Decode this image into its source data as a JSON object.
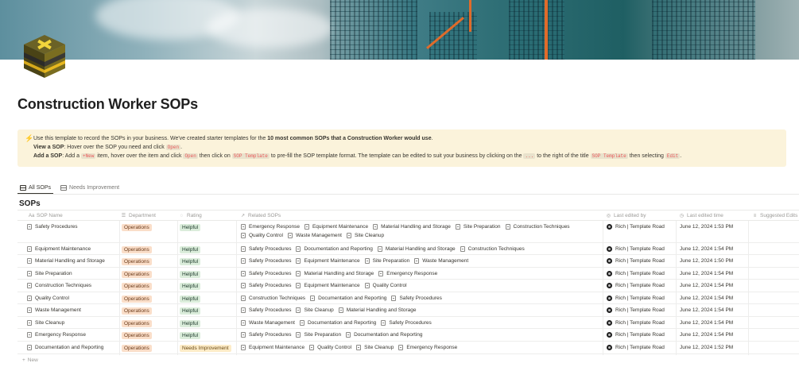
{
  "page": {
    "title": "Construction Worker SOPs"
  },
  "callout": {
    "line1_prefix": "Use this template to record the SOPs in your business. We've created starter templates for the ",
    "line1_bold": "10 most common SOPs that a Construction Worker would use",
    "line1_suffix": ".",
    "line2_bold": "View a SOP",
    "line2_text": ": Hover over the SOP you need and click ",
    "line2_code": "Open",
    "line2_end": ".",
    "line3_bold": "Add a SOP",
    "line3_a": ": Add a ",
    "line3_code_new": "+New",
    "line3_b": " item, hover over the item and click ",
    "line3_code_open": "Open",
    "line3_c": " then click on ",
    "line3_code_template": "SOP Template",
    "line3_d": " to pre-fill the SOP template format. The template can be edited to suit your business by clicking on the ",
    "line3_code_dots": "...",
    "line3_e": " to the right of the title ",
    "line3_code_template2": "SOP Template",
    "line3_f": " then selecting ",
    "line3_code_edit": "Edit",
    "line3_g": "."
  },
  "tabs": [
    {
      "label": "All SOPs",
      "active": true
    },
    {
      "label": "Needs Improvement",
      "active": false
    }
  ],
  "database": {
    "title": "SOPs",
    "columns": {
      "name": "SOP Name",
      "department": "Department",
      "rating": "Rating",
      "related": "Related SOPs",
      "last_edited_by": "Last edited by",
      "last_edited_time": "Last edited time",
      "suggested": "Suggested Edits"
    },
    "new_label": "New"
  },
  "rows": [
    {
      "name": "Safety Procedures",
      "department": "Operations",
      "rating": "Helpful",
      "related_line1": [
        "Emergency Response",
        "Equipment Maintenance",
        "Material Handling and Storage",
        "Site Preparation",
        "Construction Techniques"
      ],
      "related_line2": [
        "Quality Control",
        "Waste Management",
        "Site Cleanup"
      ],
      "editor": "Rich | Template Road",
      "time": "June 12, 2024 1:53 PM"
    },
    {
      "name": "Equipment Maintenance",
      "department": "Operations",
      "rating": "Helpful",
      "related_line1": [
        "Safety Procedures",
        "Documentation and Reporting",
        "Material Handling and Storage",
        "Construction Techniques"
      ],
      "editor": "Rich | Template Road",
      "time": "June 12, 2024 1:54 PM"
    },
    {
      "name": "Material Handling and Storage",
      "department": "Operations",
      "rating": "Helpful",
      "related_line1": [
        "Safety Procedures",
        "Equipment Maintenance",
        "Site Preparation",
        "Waste Management"
      ],
      "editor": "Rich | Template Road",
      "time": "June 12, 2024 1:50 PM"
    },
    {
      "name": "Site Preparation",
      "department": "Operations",
      "rating": "Helpful",
      "related_line1": [
        "Safety Procedures",
        "Material Handling and Storage",
        "Emergency Response"
      ],
      "editor": "Rich | Template Road",
      "time": "June 12, 2024 1:54 PM"
    },
    {
      "name": "Construction Techniques",
      "department": "Operations",
      "rating": "Helpful",
      "related_line1": [
        "Safety Procedures",
        "Equipment Maintenance",
        "Quality Control"
      ],
      "editor": "Rich | Template Road",
      "time": "June 12, 2024 1:54 PM"
    },
    {
      "name": "Quality Control",
      "department": "Operations",
      "rating": "Helpful",
      "related_line1": [
        "Construction Techniques",
        "Documentation and Reporting",
        "Safety Procedures"
      ],
      "editor": "Rich | Template Road",
      "time": "June 12, 2024 1:54 PM"
    },
    {
      "name": "Waste Management",
      "department": "Operations",
      "rating": "Helpful",
      "related_line1": [
        "Safety Procedures",
        "Site Cleanup",
        "Material Handling and Storage"
      ],
      "editor": "Rich | Template Road",
      "time": "June 12, 2024 1:54 PM"
    },
    {
      "name": "Site Cleanup",
      "department": "Operations",
      "rating": "Helpful",
      "related_line1": [
        "Waste Management",
        "Documentation and Reporting",
        "Safety Procedures"
      ],
      "editor": "Rich | Template Road",
      "time": "June 12, 2024 1:54 PM"
    },
    {
      "name": "Emergency Response",
      "department": "Operations",
      "rating": "Helpful",
      "related_line1": [
        "Safety Procedures",
        "Site Preparation",
        "Documentation and Reporting"
      ],
      "editor": "Rich | Template Road",
      "time": "June 12, 2024 1:54 PM"
    },
    {
      "name": "Documentation and Reporting",
      "department": "Operations",
      "rating": "Needs Improvement",
      "related_line1": [
        "Equipment Maintenance",
        "Quality Control",
        "Site Cleanup",
        "Emergency Response"
      ],
      "editor": "Rich | Template Road",
      "time": "June 12, 2024 1:52 PM"
    }
  ],
  "colors": {
    "operations_bg": "#fadec9",
    "helpful_bg": "#dbeddb",
    "needs_improvement_bg": "#fdecc8",
    "callout_bg": "#fbf3db",
    "code_text": "#eb5757"
  }
}
